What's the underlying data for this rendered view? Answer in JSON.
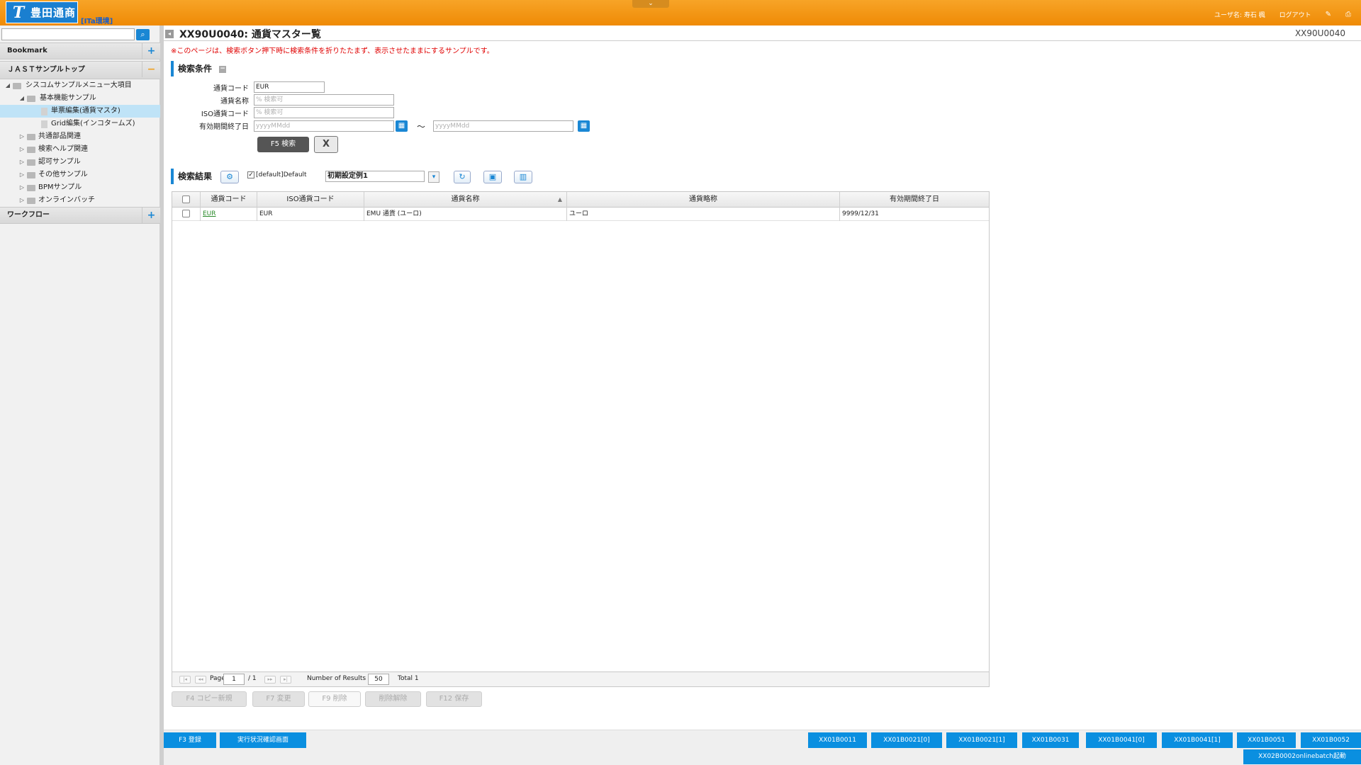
{
  "header": {
    "logo_mark": "T",
    "logo_text": "豊田通商",
    "env_label": "[ITa環境]",
    "toggle": "⌄",
    "user_label": "ユーザ名: 寿石 楓",
    "logout": "ログアウト",
    "icon_edit": "✎",
    "icon_print": "⎙"
  },
  "sidebar": {
    "search_placeholder": "",
    "search_icon": "⌕",
    "bookmark": "Bookmark",
    "jast_top": "ＪＡＳＴサンプルトップ",
    "workflow": "ワークフロー",
    "plus": "+",
    "minus": "−",
    "tree": [
      "シスコムサンプルメニュー大項目",
      "基本機能サンプル",
      "単票編集(通貨マスタ)",
      "Grid編集(インコタームズ)",
      "共通部品関連",
      "検索ヘルプ関連",
      "認可サンプル",
      "その他サンプル",
      "BPMサンプル",
      "オンラインバッチ"
    ]
  },
  "main": {
    "collapse_icon": "◂",
    "title": "XX90U0040: 通貨マスター覧",
    "page_id": "XX90U0040",
    "notice": "※このページは、検索ボタン押下時に検索条件を折りたたまず、表示させたままにするサンプルです。",
    "search_section": "検索条件",
    "result_section": "検索結果",
    "section_toggle": "−",
    "form": {
      "currency_code_label": "通貨コード",
      "currency_code_value": "EUR",
      "currency_name_label": "通貨名称",
      "currency_name_placeholder": "% 検索可",
      "iso_code_label": "ISO通貨コード",
      "iso_code_placeholder": "% 検索可",
      "expiry_label": "有効期間終了日",
      "date_placeholder": "yyyyMMdd",
      "tilde": "〜",
      "calendar_icon": "▦",
      "search_button": "F5 検索",
      "excel_icon": "X"
    },
    "result_tools": {
      "settings_icon": "⚙",
      "default_check": "✓",
      "default_label": "[default]Default",
      "preset_value": "初期設定例1",
      "dropdown_icon": "▾",
      "refresh_icon": "↻",
      "save_icon": "▣",
      "delete_icon": "▥"
    },
    "grid": {
      "columns": [
        "通貨コード",
        "ISO通貨コード",
        "通貨名称",
        "通貨略称",
        "有効期間終了日"
      ],
      "sort_icon": "▲",
      "rows": [
        {
          "code": "EUR",
          "iso": "EUR",
          "name": "EMU 通貨 (ユーロ)",
          "short": "ユーロ",
          "expiry": "9999/12/31"
        }
      ],
      "pager": {
        "first": "|◂",
        "prev": "◂◂",
        "next": "▸▸",
        "last": "▸|",
        "page_label": "Page",
        "page_value": "1",
        "page_total": "/ 1",
        "results_label": "Number of Results",
        "results_value": "50",
        "total": "Total 1"
      }
    },
    "actions": [
      "F4 コピー新規",
      "F7 変更",
      "F9 削除",
      "削除解除",
      "F12 保存"
    ]
  },
  "footer": {
    "left_buttons": [
      "F3 登録",
      "実行状況確認画面"
    ],
    "right_buttons": [
      "XX01B0011",
      "XX01B0021[0]",
      "XX01B0021[1]",
      "XX01B0031",
      "XX01B0041[0]",
      "XX01B0041[1]",
      "XX01B0051",
      "XX01B0052"
    ],
    "bottom_button": "XX02B0002onlinebatch起動"
  }
}
